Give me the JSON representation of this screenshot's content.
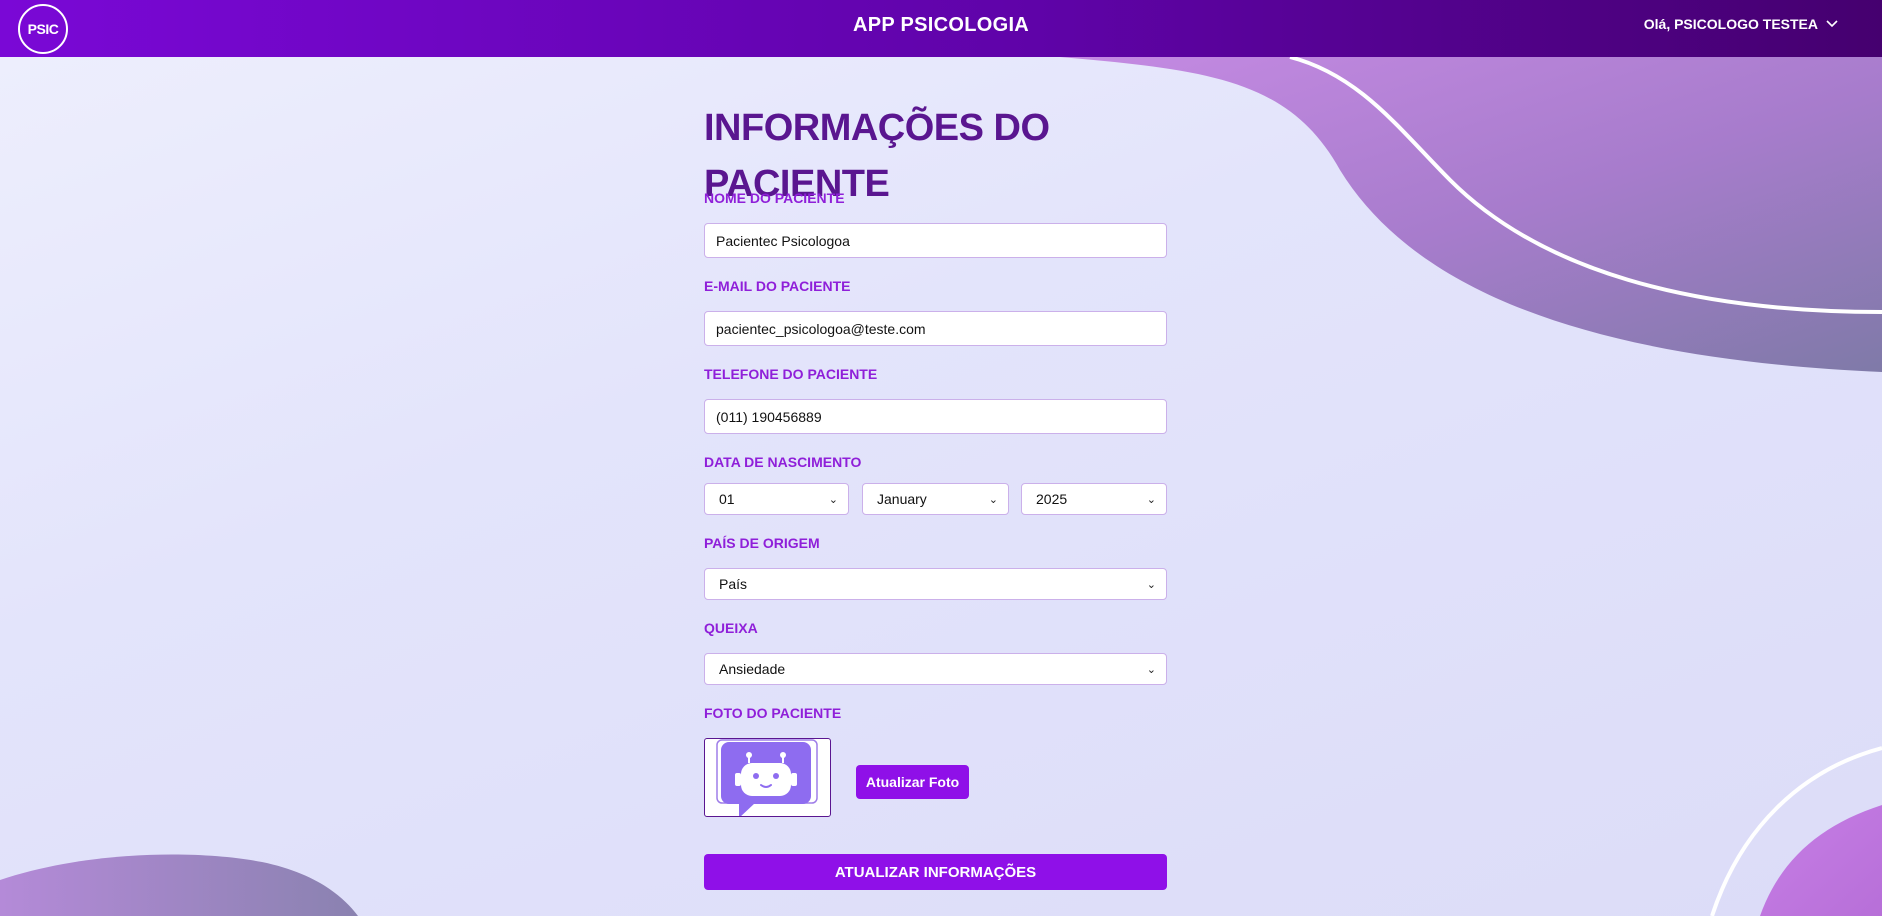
{
  "header": {
    "logo_text": "PSIC",
    "app_title": "APP PSICOLOGIA",
    "user_greeting": "Olá, PSICOLOGO TESTEA",
    "user_menu_icon": "chevron-down-icon"
  },
  "form": {
    "title": "INFORMAÇÕES DO PACIENTE",
    "name_label": "NOME DO PACIENTE",
    "name_value": "Pacientec Psicologoa",
    "email_label": "E-MAIL DO PACIENTE",
    "email_value": "pacientec_psicologoa@teste.com",
    "phone_label": "TELEFONE DO PACIENTE",
    "phone_value": "(011) 190456889",
    "birth_label": "DATA DE NASCIMENTO",
    "birth_day": "01",
    "birth_month": "January",
    "birth_year": "2025",
    "country_label": "PAÍS DE ORIGEM",
    "country_value": "País",
    "complaint_label": "QUEIXA",
    "complaint_value": "Ansiedade",
    "photo_label": "FOTO DO PACIENTE",
    "photo_icon": "robot-chat-icon",
    "update_photo_button": "Atualizar Foto",
    "submit_button": "ATUALIZAR INFORMAÇÕES"
  },
  "colors": {
    "header_start": "#7a08d6",
    "header_end": "#45006f",
    "title": "#5a1690",
    "label": "#8f1fd9",
    "button": "#8f10e8",
    "wave": "#a86fd4"
  }
}
